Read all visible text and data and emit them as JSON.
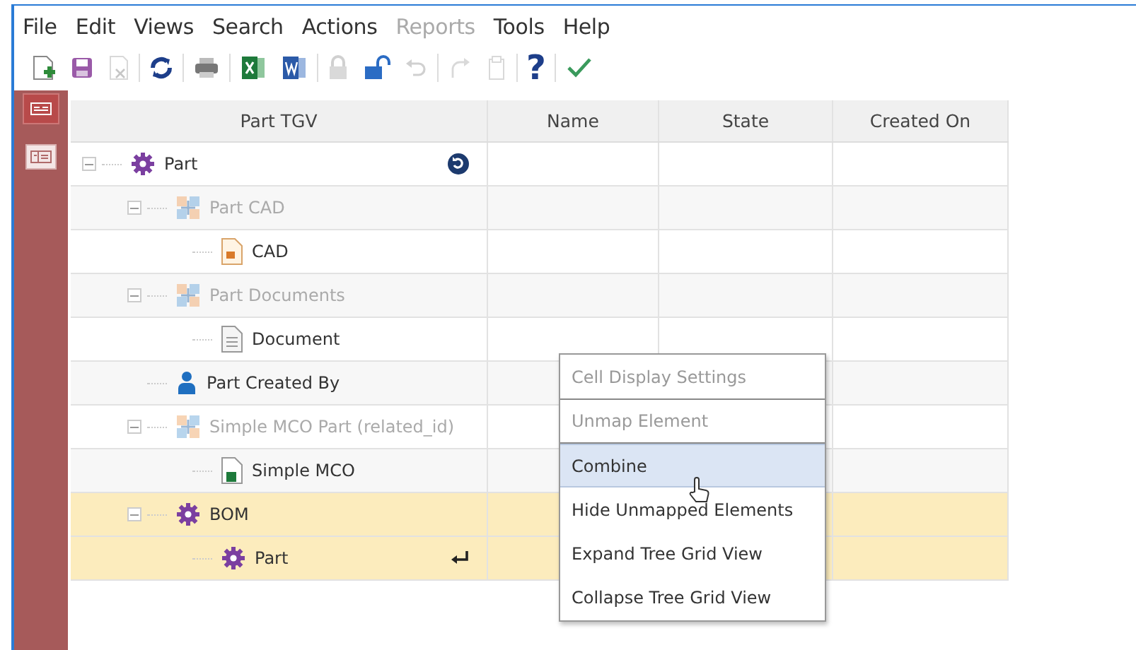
{
  "menu_bar": [
    {
      "label": "File",
      "disabled": false
    },
    {
      "label": "Edit",
      "disabled": false
    },
    {
      "label": "Views",
      "disabled": false
    },
    {
      "label": "Search",
      "disabled": false
    },
    {
      "label": "Actions",
      "disabled": false
    },
    {
      "label": "Reports",
      "disabled": true
    },
    {
      "label": "Tools",
      "disabled": false
    },
    {
      "label": "Help",
      "disabled": false
    }
  ],
  "toolbar": [
    [
      {
        "kind": "new",
        "disabled": false
      },
      {
        "kind": "save",
        "disabled": false
      },
      {
        "kind": "close",
        "disabled": true
      }
    ],
    [
      {
        "kind": "refresh",
        "disabled": false
      }
    ],
    [
      {
        "kind": "print",
        "disabled": false
      }
    ],
    [
      {
        "kind": "excel",
        "disabled": false
      },
      {
        "kind": "word",
        "disabled": false
      }
    ],
    [
      {
        "kind": "lock",
        "disabled": true
      },
      {
        "kind": "unlock",
        "disabled": false
      },
      {
        "kind": "undo",
        "disabled": true
      }
    ],
    [
      {
        "kind": "redo",
        "disabled": true
      },
      {
        "kind": "clipboard",
        "disabled": true
      }
    ],
    [
      {
        "kind": "help",
        "disabled": false,
        "glyph": "?"
      }
    ],
    [
      {
        "kind": "check",
        "disabled": false
      }
    ]
  ],
  "sidebar": [
    {
      "kind": "tree-view",
      "selected": true
    },
    {
      "kind": "grid-view",
      "selected": false
    }
  ],
  "grid": {
    "columns": [
      "Part TGV",
      "Name",
      "State",
      "Created On"
    ],
    "tree": [
      {
        "label": "Part",
        "kind": "item",
        "mapped": true,
        "highlighted": false,
        "expanded": true,
        "end_icon": {
          "kind": "link"
        },
        "children": [
          {
            "label": "Part CAD",
            "kind": "relationship",
            "mapped": false,
            "highlighted": false,
            "expanded": true,
            "children": [
              {
                "label": "CAD",
                "kind": "cad",
                "mapped": true,
                "highlighted": false
              }
            ]
          },
          {
            "label": "Part Documents",
            "kind": "relationship",
            "mapped": false,
            "highlighted": false,
            "expanded": true,
            "children": [
              {
                "label": "Document",
                "kind": "document",
                "mapped": true,
                "highlighted": false
              }
            ]
          },
          {
            "label": "Part Created By",
            "kind": "person",
            "mapped": true,
            "highlighted": false
          },
          {
            "label": "Simple MCO Part (related_id)",
            "kind": "relationship",
            "mapped": false,
            "highlighted": false,
            "expanded": true,
            "children": [
              {
                "label": "Simple MCO",
                "kind": "mco",
                "mapped": true,
                "highlighted": false
              }
            ]
          },
          {
            "label": "BOM",
            "kind": "item",
            "mapped": true,
            "highlighted": true,
            "expanded": true,
            "children": [
              {
                "label": "Part",
                "kind": "item",
                "mapped": true,
                "highlighted": true,
                "end_icon": {
                  "kind": "return"
                }
              }
            ]
          }
        ]
      }
    ]
  },
  "context_menu": [
    {
      "label": "Cell Display Settings",
      "disabled": true,
      "selected": false,
      "divider": true
    },
    {
      "label": "Unmap Element",
      "disabled": true,
      "selected": false,
      "divider": true
    },
    {
      "label": "Combine",
      "disabled": false,
      "selected": true,
      "divider": false
    },
    {
      "label": "Hide Unmapped Elements",
      "disabled": false,
      "selected": false,
      "divider": false
    },
    {
      "label": "Expand Tree Grid View",
      "disabled": false,
      "selected": false,
      "divider": false
    },
    {
      "label": "Collapse Tree Grid View",
      "disabled": false,
      "selected": false,
      "divider": false
    }
  ]
}
